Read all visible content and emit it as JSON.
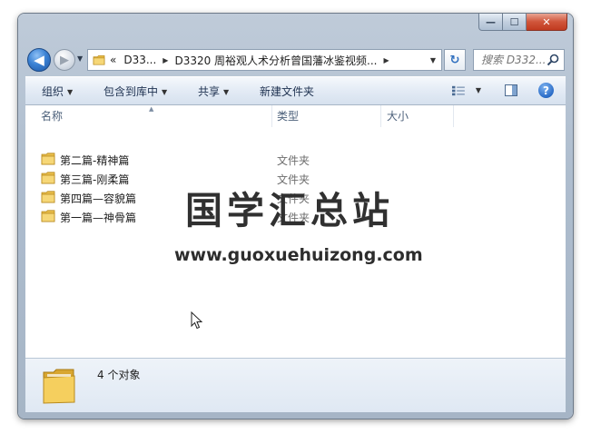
{
  "window": {
    "caption_buttons": {
      "minimize": "—",
      "maximize": "☐",
      "close": "✕"
    }
  },
  "nav": {
    "back_glyph": "◀",
    "forward_glyph": "▶",
    "address": {
      "overflow_glyph": "«",
      "crumbs": [
        "D33...",
        "D3320 周裕观人术分析曾国藩冰鉴视频..."
      ],
      "separator_glyph": "▶"
    },
    "refresh_glyph": "↻",
    "search_placeholder": "搜索 D332..."
  },
  "command_bar": {
    "items": [
      "组织",
      "包含到库中",
      "共享",
      "新建文件夹"
    ]
  },
  "columns": {
    "name": "名称",
    "type": "类型",
    "size": "大小"
  },
  "files": [
    {
      "name": "第二篇-精神篇",
      "type": "文件夹"
    },
    {
      "name": "第三篇-刚柔篇",
      "type": "文件夹"
    },
    {
      "name": "第四篇—容貌篇",
      "type": "文件夹"
    },
    {
      "name": "第一篇—神骨篇",
      "type": "文件夹"
    }
  ],
  "watermark": {
    "title": "国学汇总站",
    "url": "www.guoxuehuizong.com"
  },
  "details": {
    "count": "4 个对象"
  },
  "icons": {
    "folder": "folder-icon",
    "search": "search-icon",
    "help": "help-icon",
    "views": "views-icon",
    "preview_pane": "preview-pane-icon"
  },
  "colors": {
    "folder": "#e8bd4a",
    "accent_blue": "#2a6cc7",
    "close_red": "#c13a20"
  }
}
